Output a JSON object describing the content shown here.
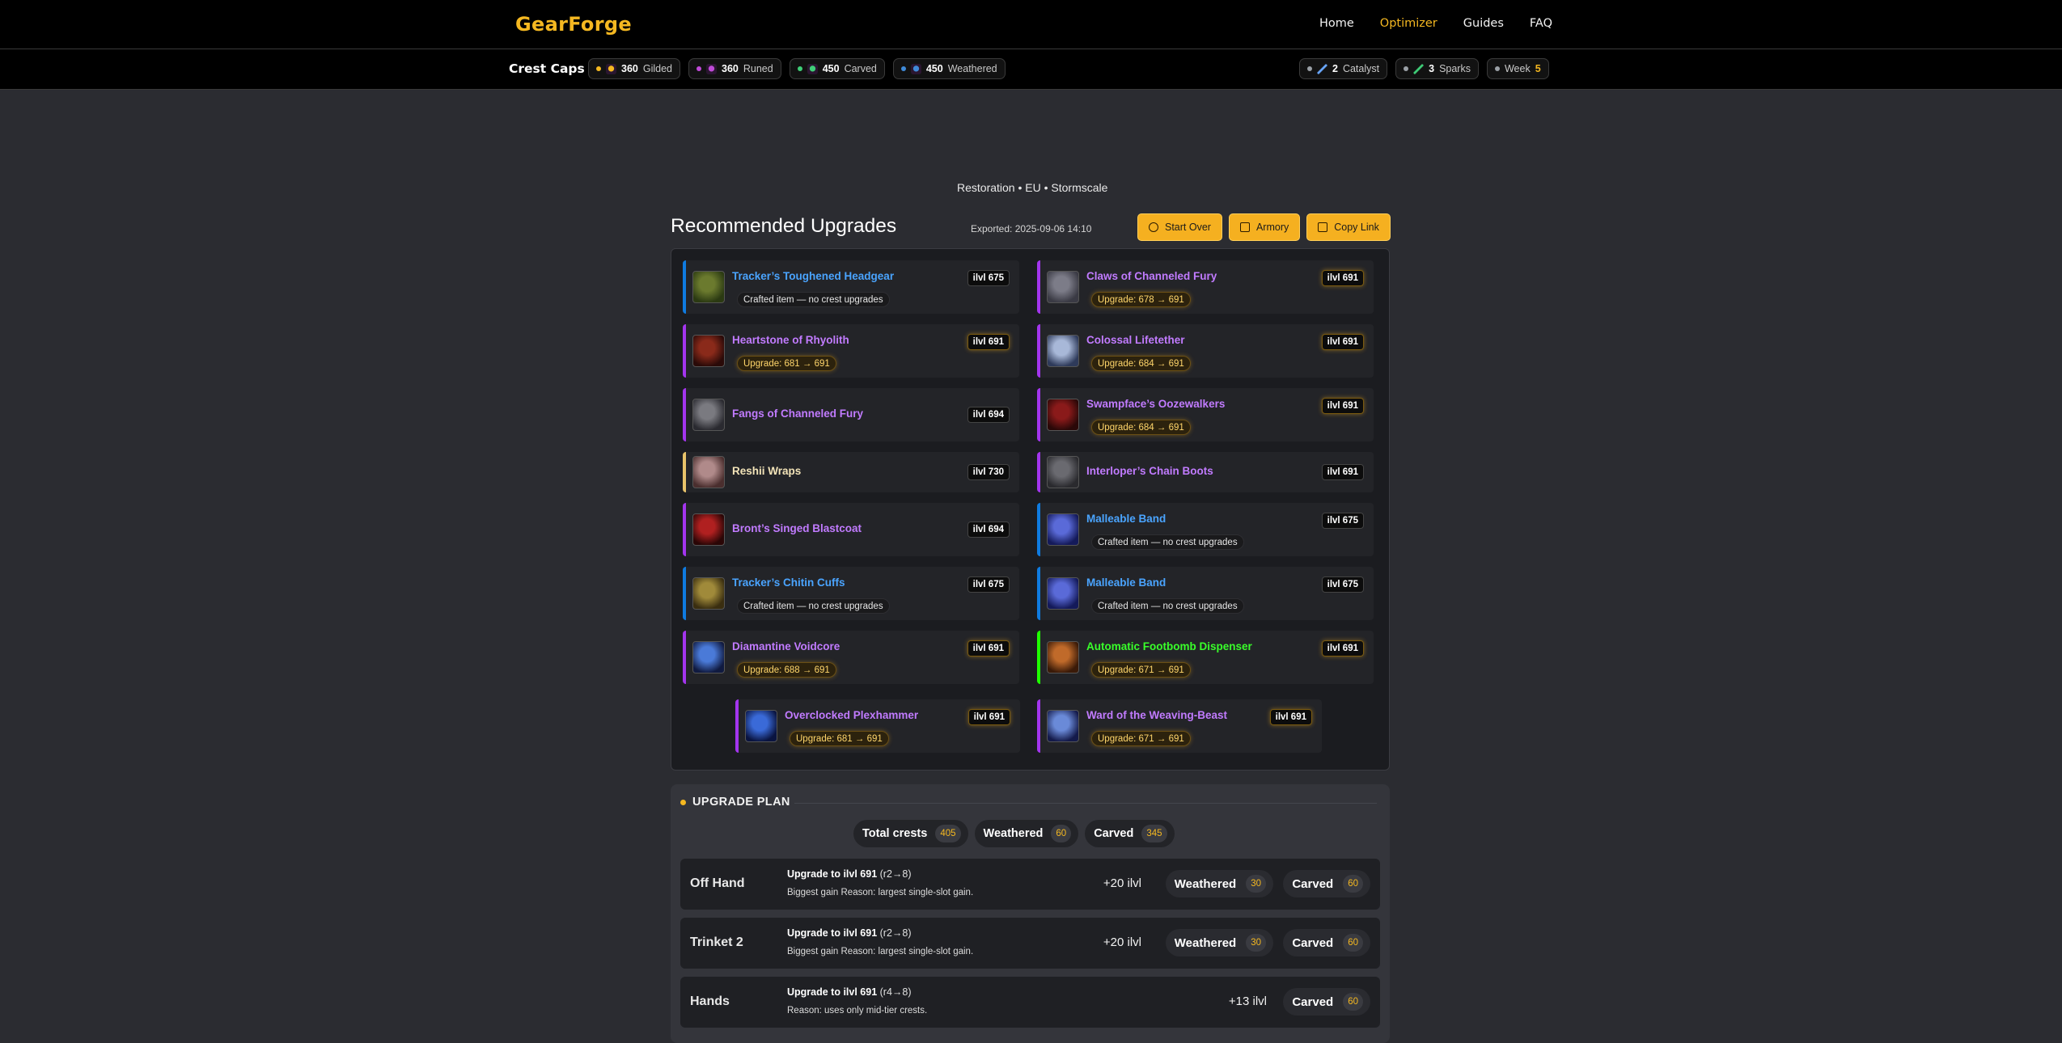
{
  "nav": {
    "brand": "GearForge",
    "links": [
      "Home",
      "Optimizer",
      "Guides",
      "FAQ"
    ],
    "active": "Optimizer"
  },
  "crests": {
    "title": "Crest Caps",
    "caps": [
      {
        "num": "360",
        "label": "Gilded",
        "color": "#f5b820",
        "icon": "gilded-crest-icon"
      },
      {
        "num": "360",
        "label": "Runed",
        "color": "#c04ad8",
        "icon": "runed-crest-icon"
      },
      {
        "num": "450",
        "label": "Carved",
        "color": "#3fcf78",
        "icon": "carved-crest-icon"
      },
      {
        "num": "450",
        "label": "Weathered",
        "color": "#3f8ad8",
        "icon": "weathered-crest-icon"
      }
    ],
    "extras": [
      {
        "num": "2",
        "label": "Catalyst",
        "color": "#6aa8ff",
        "icon": "catalyst-icon"
      },
      {
        "num": "3",
        "label": "Sparks",
        "color": "#3fcf78",
        "icon": "sparks-icon"
      },
      {
        "label": "Week",
        "num": "5"
      }
    ]
  },
  "header": {
    "spec_line": "Restoration • EU • Stormscale",
    "title": "Recommended Upgrades",
    "exported": "Exported: 2025-09-06 14:10",
    "buttons": [
      "Start Over",
      "Armory",
      "Copy Link"
    ]
  },
  "items": [
    {
      "name": "Tracker’s Toughened Headgear",
      "ilvl": "ilvl 675",
      "sub": "Crafted item — no crest upgrades",
      "sub_type": "crafted",
      "quality": "blue",
      "highlight": false
    },
    {
      "name": "Claws of Channeled Fury",
      "ilvl": "ilvl 691",
      "sub": "Upgrade: 678 → 691",
      "sub_type": "upgrade",
      "quality": "purple",
      "highlight": true
    },
    {
      "name": "Heartstone of Rhyolith",
      "ilvl": "ilvl 691",
      "sub": "Upgrade: 681 → 691",
      "sub_type": "upgrade",
      "quality": "purple",
      "highlight": true
    },
    {
      "name": "Colossal Lifetether",
      "ilvl": "ilvl 691",
      "sub": "Upgrade: 684 → 691",
      "sub_type": "upgrade",
      "quality": "purple",
      "highlight": true
    },
    {
      "name": "Fangs of Channeled Fury",
      "ilvl": "ilvl 694",
      "sub": "",
      "sub_type": "none",
      "quality": "purple",
      "highlight": false
    },
    {
      "name": "Swampface’s Oozewalkers",
      "ilvl": "ilvl 691",
      "sub": "Upgrade: 684 → 691",
      "sub_type": "upgrade",
      "quality": "purple",
      "highlight": true
    },
    {
      "name": "Reshii Wraps",
      "ilvl": "ilvl 730",
      "sub": "",
      "sub_type": "none",
      "quality": "gold",
      "highlight": false
    },
    {
      "name": "Interloper’s Chain Boots",
      "ilvl": "ilvl 691",
      "sub": "",
      "sub_type": "none",
      "quality": "purple",
      "highlight": false
    },
    {
      "name": "Bront’s Singed Blastcoat",
      "ilvl": "ilvl 694",
      "sub": "",
      "sub_type": "none",
      "quality": "purple",
      "highlight": false
    },
    {
      "name": "Malleable Band",
      "ilvl": "ilvl 675",
      "sub": "Crafted item — no crest upgrades",
      "sub_type": "crafted",
      "quality": "blue",
      "highlight": false
    },
    {
      "name": "Tracker’s Chitin Cuffs",
      "ilvl": "ilvl 675",
      "sub": "Crafted item — no crest upgrades",
      "sub_type": "crafted",
      "quality": "blue",
      "highlight": false
    },
    {
      "name": "Malleable Band",
      "ilvl": "ilvl 675",
      "sub": "Crafted item — no crest upgrades",
      "sub_type": "crafted",
      "quality": "blue",
      "highlight": false
    },
    {
      "name": "Diamantine Voidcore",
      "ilvl": "ilvl 691",
      "sub": "Upgrade: 688 → 691",
      "sub_type": "upgrade",
      "quality": "purple",
      "highlight": true
    },
    {
      "name": "Automatic Footbomb Dispenser",
      "ilvl": "ilvl 691",
      "sub": "Upgrade: 671 → 691",
      "sub_type": "upgrade",
      "quality": "green",
      "highlight": true
    },
    {
      "name": "Overclocked Plexhammer",
      "ilvl": "ilvl 691",
      "sub": "Upgrade: 681 → 691",
      "sub_type": "upgrade",
      "quality": "purple",
      "highlight": true
    },
    {
      "name": "Ward of the Weaving-Beast",
      "ilvl": "ilvl 691",
      "sub": "Upgrade: 671 → 691",
      "sub_type": "upgrade",
      "quality": "purple",
      "highlight": true
    }
  ],
  "plan": {
    "title": "UPGRADE PLAN",
    "totals": [
      {
        "label": "Total crests",
        "value": "405"
      },
      {
        "label": "Weathered",
        "value": "60"
      },
      {
        "label": "Carved",
        "value": "345"
      }
    ],
    "rows": [
      {
        "slot": "Off Hand",
        "title": "Upgrade to ilvl 691",
        "steps": "(r2→8)",
        "desc": "Biggest gain   Reason: largest single-slot gain.",
        "gain": "+20 ilvl",
        "crests": [
          {
            "label": "Weathered",
            "value": "30"
          },
          {
            "label": "Carved",
            "value": "60"
          }
        ]
      },
      {
        "slot": "Trinket 2",
        "title": "Upgrade to ilvl 691",
        "steps": "(r2→8)",
        "desc": "Biggest gain   Reason: largest single-slot gain.",
        "gain": "+20 ilvl",
        "crests": [
          {
            "label": "Weathered",
            "value": "30"
          },
          {
            "label": "Carved",
            "value": "60"
          }
        ]
      },
      {
        "slot": "Hands",
        "title": "Upgrade to ilvl 691",
        "steps": "(r4→8)",
        "desc": "Reason: uses only mid-tier crests.",
        "gain": "+13 ilvl",
        "crests": [
          {
            "label": "Carved",
            "value": "60"
          }
        ]
      }
    ]
  }
}
